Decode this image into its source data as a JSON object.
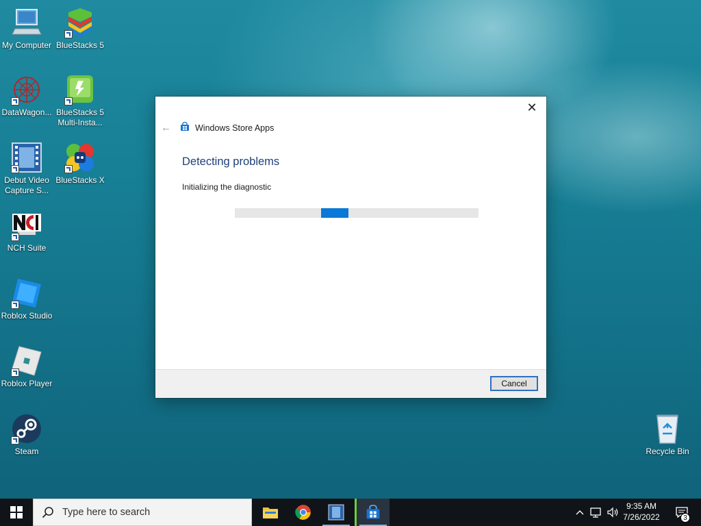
{
  "desktop": {
    "icons": [
      {
        "label": "My Computer"
      },
      {
        "label": "BlueStacks 5"
      },
      {
        "label": "DataWagon..."
      },
      {
        "label": "BlueStacks 5 Multi-Insta..."
      },
      {
        "label": "Debut Video Capture S..."
      },
      {
        "label": "BlueStacks X"
      },
      {
        "label": "NCH Suite"
      },
      {
        "label": "Roblox Studio"
      },
      {
        "label": "Roblox Player"
      },
      {
        "label": "Steam"
      },
      {
        "label": "Recycle Bin"
      }
    ]
  },
  "dialog": {
    "header_title": "Windows Store Apps",
    "title": "Detecting problems",
    "subtitle": "Initializing the diagnostic",
    "close_glyph": "✕",
    "back_glyph": "←",
    "cancel_label": "Cancel",
    "accent_color": "#0a78d7"
  },
  "taskbar": {
    "search_placeholder": "Type here to search",
    "apps": [
      {
        "icon": "file-explorer-icon"
      },
      {
        "icon": "chrome-icon"
      },
      {
        "icon": "debut-video-icon"
      },
      {
        "icon": "microsoft-store-icon",
        "active": true
      }
    ],
    "time": "9:35 AM",
    "date": "7/26/2022",
    "notification_count": "3"
  }
}
